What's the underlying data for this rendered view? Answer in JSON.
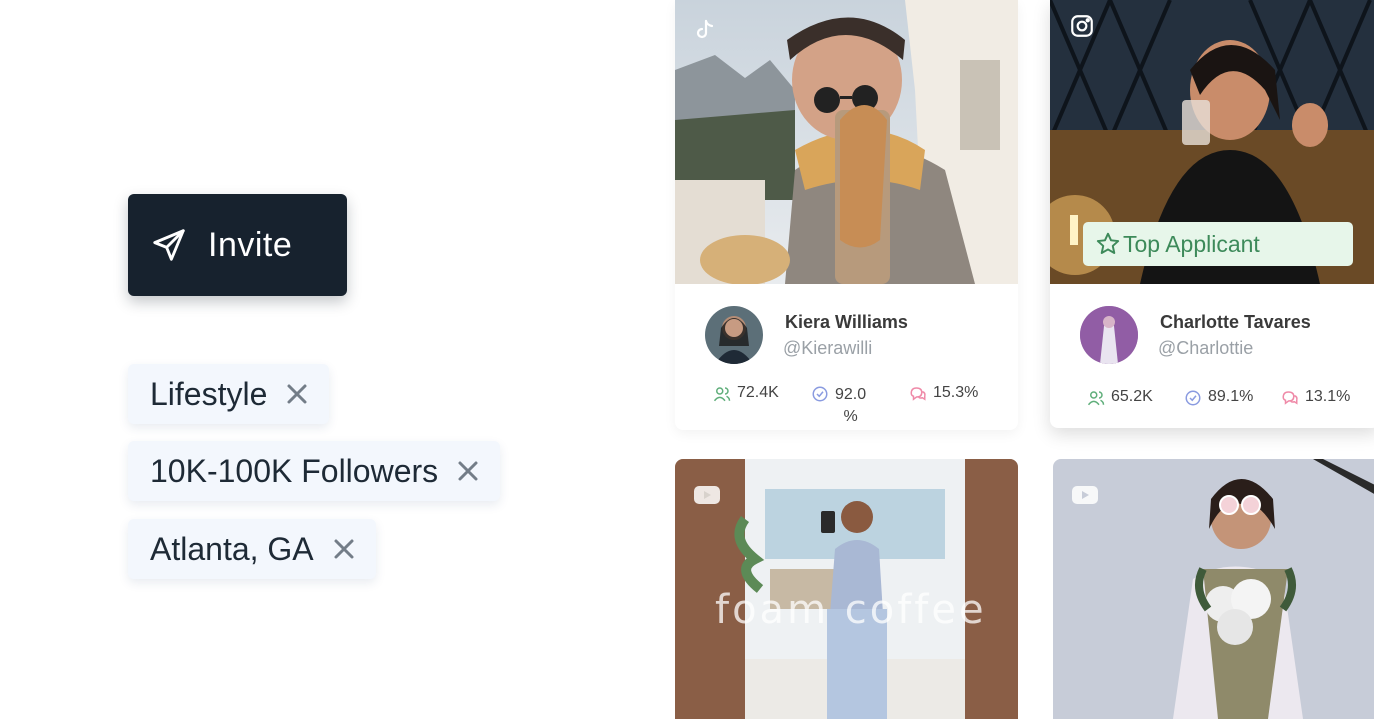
{
  "invite": {
    "label": "Invite",
    "icon": "paper-plane-icon"
  },
  "filters": [
    {
      "label": "Lifestyle"
    },
    {
      "label": "10K-100K Followers"
    },
    {
      "label": "Atlanta, GA"
    }
  ],
  "creators": [
    {
      "platform": "tiktok",
      "name": "Kiera Williams",
      "handle": "@Kierawilli",
      "followers": "72.4K",
      "approval": "92.0",
      "approval_unit": "%",
      "engagement": "15.3%"
    },
    {
      "platform": "instagram",
      "badge": "Top Applicant",
      "name": "Charlotte Tavares",
      "handle": "@Charlottie",
      "followers": "65.2K",
      "approval": "89.1%",
      "engagement": "13.1%"
    },
    {
      "platform": "youtube",
      "overlay_text": "foam coffee"
    },
    {
      "platform": "youtube"
    }
  ],
  "colors": {
    "invite_bg": "#17222e",
    "chip_bg": "#f3f7fd",
    "badge_bg": "#e7f6ea",
    "badge_text": "#3d8a5a",
    "followers_icon": "#5fae7a",
    "approval_icon": "#8a9be0",
    "engagement_icon": "#ef8aa8"
  }
}
